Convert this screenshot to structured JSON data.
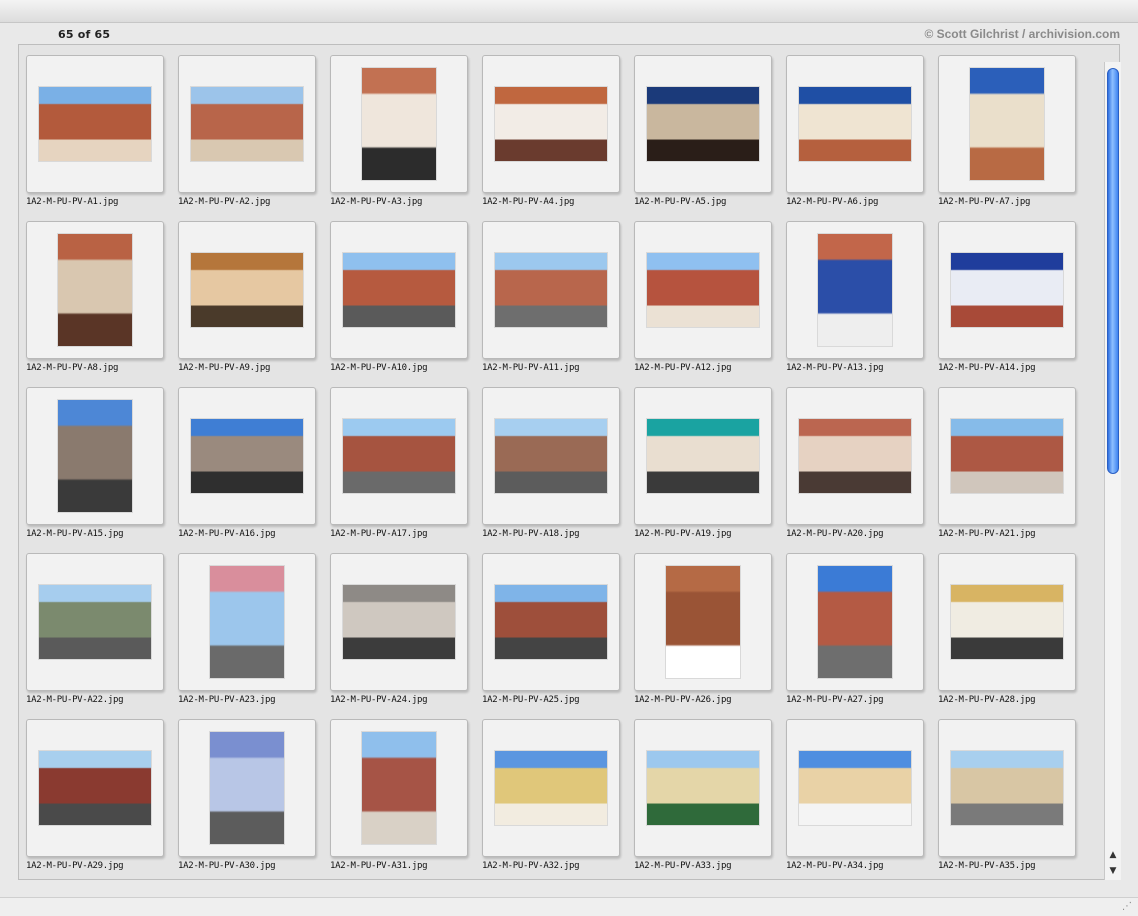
{
  "header": {
    "count": "65 of 65",
    "credit": "© Scott Gilchrist / archivision.com"
  },
  "scroll": {
    "position_fraction": 0.0,
    "visible_fraction": 0.52
  },
  "items": [
    {
      "label": "1A2-M-PU-PV-A1.jpg",
      "orientation": "landscape",
      "colors": [
        "#7ab0e6",
        "#b35a3c",
        "#e6d4c0"
      ]
    },
    {
      "label": "1A2-M-PU-PV-A2.jpg",
      "orientation": "landscape",
      "colors": [
        "#9cc4ea",
        "#b8654a",
        "#d9c8b1"
      ]
    },
    {
      "label": "1A2-M-PU-PV-A3.jpg",
      "orientation": "portrait",
      "colors": [
        "#c27152",
        "#efe6dc",
        "#2c2c2c"
      ]
    },
    {
      "label": "1A2-M-PU-PV-A4.jpg",
      "orientation": "landscape",
      "colors": [
        "#c0673f",
        "#f2ece6",
        "#6a3b2e"
      ]
    },
    {
      "label": "1A2-M-PU-PV-A5.jpg",
      "orientation": "landscape",
      "colors": [
        "#1b3a7a",
        "#c9b79e",
        "#2a1e18"
      ]
    },
    {
      "label": "1A2-M-PU-PV-A6.jpg",
      "orientation": "landscape",
      "colors": [
        "#1f4fa5",
        "#efe4d2",
        "#b5603e"
      ]
    },
    {
      "label": "1A2-M-PU-PV-A7.jpg",
      "orientation": "portrait",
      "colors": [
        "#2b5fba",
        "#eadfcb",
        "#b86a44"
      ]
    },
    {
      "label": "1A2-M-PU-PV-A8.jpg",
      "orientation": "portrait",
      "colors": [
        "#b96244",
        "#d9c7b0",
        "#5a3526"
      ]
    },
    {
      "label": "1A2-M-PU-PV-A9.jpg",
      "orientation": "landscape",
      "colors": [
        "#b5763b",
        "#e6c8a2",
        "#4a3a2a"
      ]
    },
    {
      "label": "1A2-M-PU-PV-A10.jpg",
      "orientation": "landscape",
      "colors": [
        "#8fc0ee",
        "#b65a3f",
        "#5a5a5a"
      ]
    },
    {
      "label": "1A2-M-PU-PV-A11.jpg",
      "orientation": "landscape",
      "colors": [
        "#9cc8ee",
        "#b8664c",
        "#6e6e6e"
      ]
    },
    {
      "label": "1A2-M-PU-PV-A12.jpg",
      "orientation": "landscape",
      "colors": [
        "#8fc0f0",
        "#b6533e",
        "#ebe1d4"
      ]
    },
    {
      "label": "1A2-M-PU-PV-A13.jpg",
      "orientation": "portrait",
      "colors": [
        "#c2664a",
        "#2b4ea8",
        "#eeeeee"
      ]
    },
    {
      "label": "1A2-M-PU-PV-A14.jpg",
      "orientation": "landscape",
      "colors": [
        "#1f3d9c",
        "#e9ecf4",
        "#a84a38"
      ]
    },
    {
      "label": "1A2-M-PU-PV-A15.jpg",
      "orientation": "portrait",
      "colors": [
        "#4d87d6",
        "#8a7a6e",
        "#3a3a3a"
      ]
    },
    {
      "label": "1A2-M-PU-PV-A16.jpg",
      "orientation": "landscape",
      "colors": [
        "#3f7ed4",
        "#9a8a7e",
        "#2f2f2f"
      ]
    },
    {
      "label": "1A2-M-PU-PV-A17.jpg",
      "orientation": "landscape",
      "colors": [
        "#9ccaf0",
        "#a65440",
        "#6a6a6a"
      ]
    },
    {
      "label": "1A2-M-PU-PV-A18.jpg",
      "orientation": "landscape",
      "colors": [
        "#a7cff0",
        "#9a6a55",
        "#5c5c5c"
      ]
    },
    {
      "label": "1A2-M-PU-PV-A19.jpg",
      "orientation": "landscape",
      "colors": [
        "#1aa3a1",
        "#e9ded0",
        "#3a3a3a"
      ]
    },
    {
      "label": "1A2-M-PU-PV-A20.jpg",
      "orientation": "landscape",
      "colors": [
        "#bb6650",
        "#e6d2c2",
        "#4a3a34"
      ]
    },
    {
      "label": "1A2-M-PU-PV-A21.jpg",
      "orientation": "landscape",
      "colors": [
        "#86bbe9",
        "#ad5844",
        "#d0c6bc"
      ]
    },
    {
      "label": "1A2-M-PU-PV-A22.jpg",
      "orientation": "landscape",
      "colors": [
        "#a6cdee",
        "#7b8a6e",
        "#5a5a5a"
      ]
    },
    {
      "label": "1A2-M-PU-PV-A23.jpg",
      "orientation": "portrait",
      "colors": [
        "#d98e9c",
        "#9cc6ec",
        "#6a6a6a"
      ]
    },
    {
      "label": "1A2-M-PU-PV-A24.jpg",
      "orientation": "landscape",
      "colors": [
        "#8e8a86",
        "#cfc8c0",
        "#3c3c3c"
      ]
    },
    {
      "label": "1A2-M-PU-PV-A25.jpg",
      "orientation": "landscape",
      "colors": [
        "#7fb4e8",
        "#9e4f3b",
        "#444444"
      ]
    },
    {
      "label": "1A2-M-PU-PV-A26.jpg",
      "orientation": "portrait",
      "colors": [
        "#b56a45",
        "#9a5436",
        "#ffffff"
      ]
    },
    {
      "label": "1A2-M-PU-PV-A27.jpg",
      "orientation": "portrait",
      "colors": [
        "#3b7bd6",
        "#b45a44",
        "#6e6e6e"
      ]
    },
    {
      "label": "1A2-M-PU-PV-A28.jpg",
      "orientation": "landscape",
      "colors": [
        "#d8b463",
        "#f0ece2",
        "#3a3a3a"
      ]
    },
    {
      "label": "1A2-M-PU-PV-A29.jpg",
      "orientation": "landscape",
      "colors": [
        "#a8cfee",
        "#8a3a30",
        "#4a4a4a"
      ]
    },
    {
      "label": "1A2-M-PU-PV-A30.jpg",
      "orientation": "portrait",
      "colors": [
        "#7a8fd0",
        "#b8c6e6",
        "#5c5c5c"
      ]
    },
    {
      "label": "1A2-M-PU-PV-A31.jpg",
      "orientation": "portrait",
      "colors": [
        "#8fbfec",
        "#a65446",
        "#d9d1c6"
      ]
    },
    {
      "label": "1A2-M-PU-PV-A32.jpg",
      "orientation": "landscape",
      "colors": [
        "#5b96e0",
        "#e0c77a",
        "#f2ece0"
      ]
    },
    {
      "label": "1A2-M-PU-PV-A33.jpg",
      "orientation": "landscape",
      "colors": [
        "#9cc8ee",
        "#e4d6a8",
        "#2f6a3a"
      ]
    },
    {
      "label": "1A2-M-PU-PV-A34.jpg",
      "orientation": "landscape",
      "colors": [
        "#4f8ee0",
        "#e9d2a6",
        "#f4f4f4"
      ]
    },
    {
      "label": "1A2-M-PU-PV-A35.jpg",
      "orientation": "landscape",
      "colors": [
        "#a8cfee",
        "#d8c6a4",
        "#7a7a7a"
      ]
    }
  ]
}
